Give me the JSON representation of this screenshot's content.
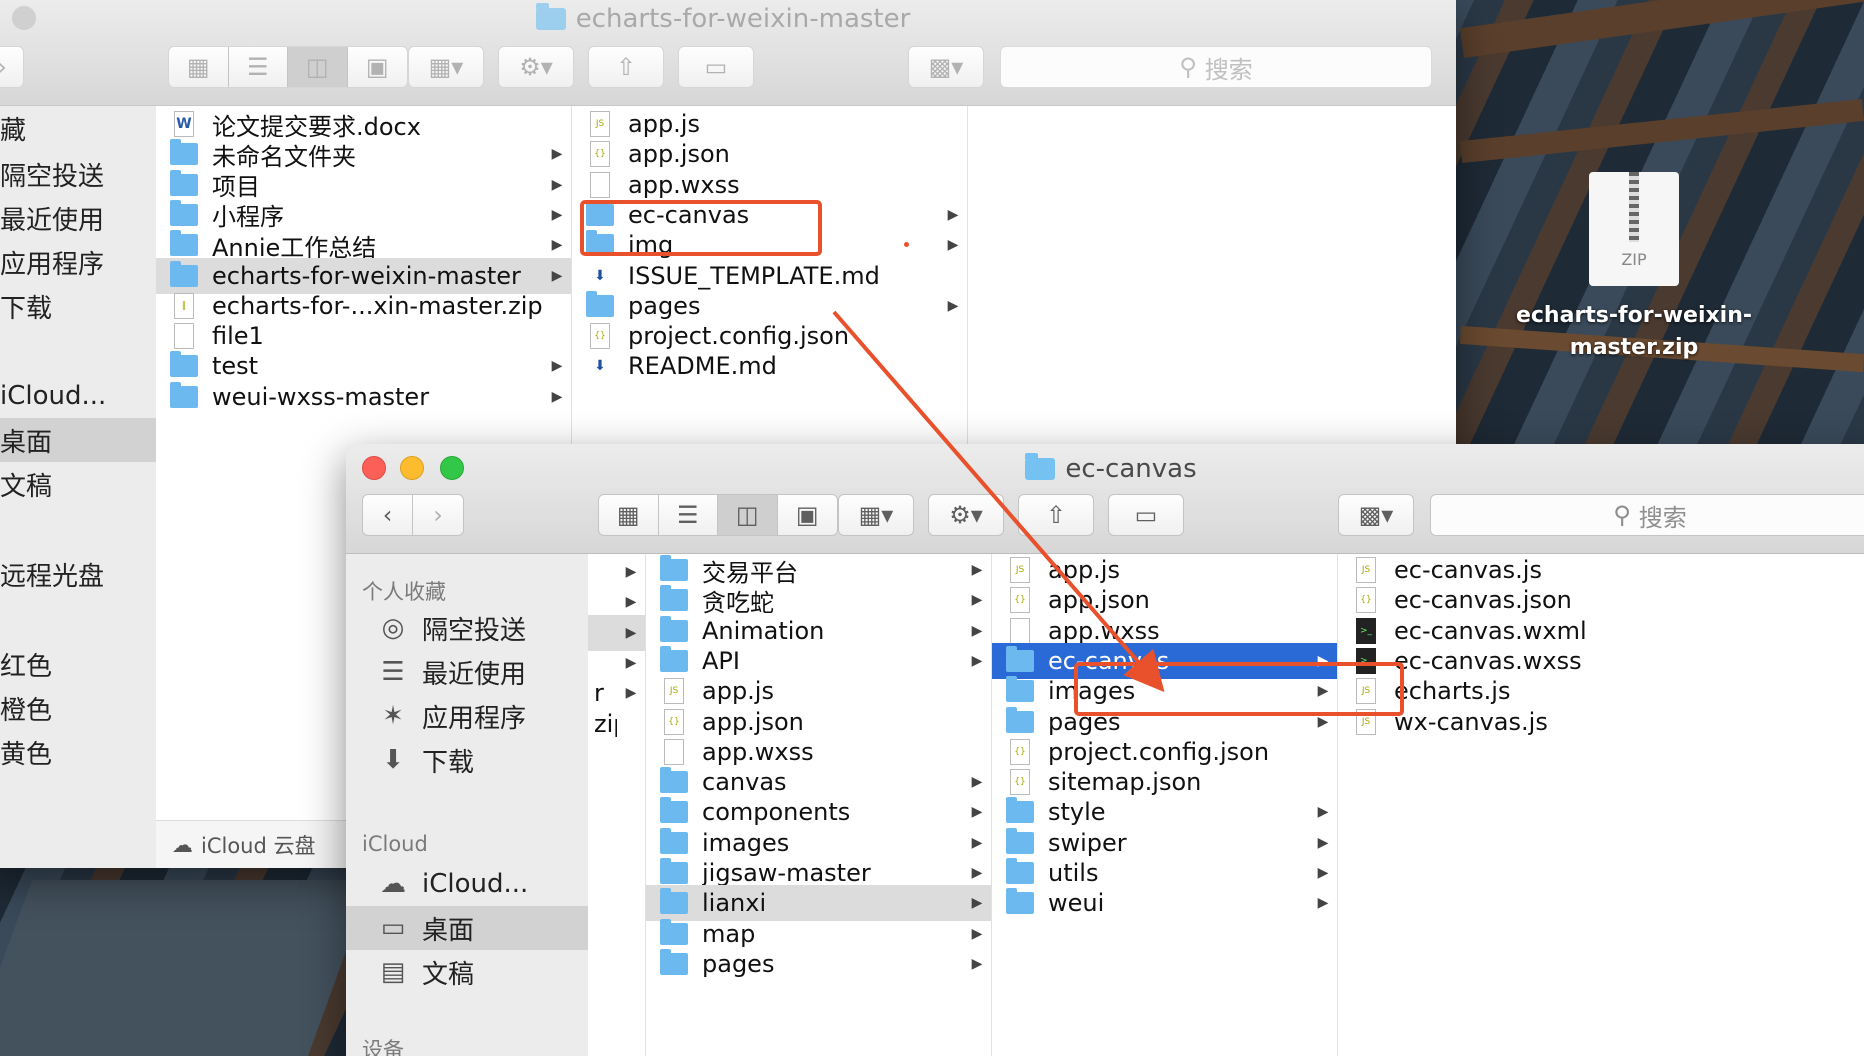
{
  "back_window": {
    "title": "echarts-for-weixin-master",
    "search_placeholder": "搜索",
    "sidebar_items": [
      "藏",
      "隔空投送",
      "最近使用",
      "应用程序",
      "下载",
      "iCloud...",
      "桌面",
      "文稿",
      "远程光盘",
      "红色",
      "橙色",
      "黄色"
    ],
    "icloud_status": "iCloud 云盘",
    "column1": [
      {
        "name": "论文提交要求.docx",
        "type": "word",
        "arrow": false
      },
      {
        "name": "未命名文件夹",
        "type": "folder",
        "arrow": true
      },
      {
        "name": "项目",
        "type": "folder",
        "arrow": true
      },
      {
        "name": "小程序",
        "type": "folder",
        "arrow": true
      },
      {
        "name": "Annie工作总结",
        "type": "folder",
        "arrow": true
      },
      {
        "name": "echarts-for-weixin-master",
        "type": "folder",
        "arrow": true,
        "highlight": true
      },
      {
        "name": "echarts-for-...xin-master.zip",
        "type": "zip",
        "arrow": false
      },
      {
        "name": "file1",
        "type": "file",
        "arrow": false
      },
      {
        "name": "test",
        "type": "folder",
        "arrow": true
      },
      {
        "name": "weui-wxss-master",
        "type": "folder",
        "arrow": true
      }
    ],
    "column2": [
      {
        "name": "app.js",
        "type": "js",
        "arrow": false
      },
      {
        "name": "app.json",
        "type": "json",
        "arrow": false
      },
      {
        "name": "app.wxss",
        "type": "file",
        "arrow": false
      },
      {
        "name": "ec-canvas",
        "type": "folder",
        "arrow": true
      },
      {
        "name": "img",
        "type": "folder",
        "arrow": true
      },
      {
        "name": "ISSUE_TEMPLATE.md",
        "type": "md",
        "arrow": false
      },
      {
        "name": "pages",
        "type": "folder",
        "arrow": true
      },
      {
        "name": "project.config.json",
        "type": "json",
        "arrow": false
      },
      {
        "name": "README.md",
        "type": "md",
        "arrow": false
      }
    ]
  },
  "front_window": {
    "title": "ec-canvas",
    "search_placeholder": "搜索",
    "sidebar": {
      "favorites_header": "个人收藏",
      "favorites": [
        {
          "label": "隔空投送",
          "icon": "airdrop-icon"
        },
        {
          "label": "最近使用",
          "icon": "recents-icon"
        },
        {
          "label": "应用程序",
          "icon": "applications-icon"
        },
        {
          "label": "下载",
          "icon": "downloads-icon"
        }
      ],
      "icloud_header": "iCloud",
      "icloud": [
        {
          "label": "iCloud...",
          "icon": "cloud-icon"
        },
        {
          "label": "桌面",
          "icon": "desktop-icon",
          "selected": true
        },
        {
          "label": "文稿",
          "icon": "documents-icon"
        }
      ],
      "devices_header": "设备"
    },
    "column0": [
      {
        "name": "",
        "arrow": true
      },
      {
        "name": "",
        "arrow": true
      },
      {
        "name": "",
        "arrow": true,
        "highlight": true
      },
      {
        "name": "",
        "arrow": true
      },
      {
        "name": "r",
        "arrow": true
      },
      {
        "name": "zip",
        "arrow": false
      }
    ],
    "column1": [
      {
        "name": "交易平台",
        "type": "folder",
        "arrow": true
      },
      {
        "name": "贪吃蛇",
        "type": "folder",
        "arrow": true
      },
      {
        "name": "Animation",
        "type": "folder",
        "arrow": true
      },
      {
        "name": "API",
        "type": "folder",
        "arrow": true
      },
      {
        "name": "app.js",
        "type": "js",
        "arrow": false
      },
      {
        "name": "app.json",
        "type": "json",
        "arrow": false
      },
      {
        "name": "app.wxss",
        "type": "file",
        "arrow": false
      },
      {
        "name": "canvas",
        "type": "folder",
        "arrow": true
      },
      {
        "name": "components",
        "type": "folder",
        "arrow": true
      },
      {
        "name": "images",
        "type": "folder",
        "arrow": true
      },
      {
        "name": "jigsaw-master",
        "type": "folder",
        "arrow": true
      },
      {
        "name": "lianxi",
        "type": "folder",
        "arrow": true,
        "highlight": true
      },
      {
        "name": "map",
        "type": "folder",
        "arrow": true
      },
      {
        "name": "pages",
        "type": "folder",
        "arrow": true
      }
    ],
    "column2": [
      {
        "name": "app.js",
        "type": "js",
        "arrow": false
      },
      {
        "name": "app.json",
        "type": "json",
        "arrow": false
      },
      {
        "name": "app.wxss",
        "type": "file",
        "arrow": false
      },
      {
        "name": "ec-canvas",
        "type": "folder",
        "arrow": true,
        "selected": true
      },
      {
        "name": "images",
        "type": "folder",
        "arrow": true
      },
      {
        "name": "pages",
        "type": "folder",
        "arrow": true
      },
      {
        "name": "project.config.json",
        "type": "json",
        "arrow": false
      },
      {
        "name": "sitemap.json",
        "type": "json",
        "arrow": false
      },
      {
        "name": "style",
        "type": "folder",
        "arrow": true
      },
      {
        "name": "swiper",
        "type": "folder",
        "arrow": true
      },
      {
        "name": "utils",
        "type": "folder",
        "arrow": true
      },
      {
        "name": "weui",
        "type": "folder",
        "arrow": true
      }
    ],
    "column3": [
      {
        "name": "ec-canvas.js",
        "type": "js"
      },
      {
        "name": "ec-canvas.json",
        "type": "json"
      },
      {
        "name": "ec-canvas.wxml",
        "type": "terminal"
      },
      {
        "name": "ec-canvas.wxss",
        "type": "terminal"
      },
      {
        "name": "echarts.js",
        "type": "js"
      },
      {
        "name": "wx-canvas.js",
        "type": "js"
      }
    ]
  },
  "desktop": {
    "zip_icon_label": "ZIP",
    "zip_name": "echarts-for-weixin-master.zip"
  },
  "colors": {
    "selection": "#2a6ad6",
    "annotation": "#e8512b",
    "folder": "#6cb9f0",
    "close": "#fc5f57",
    "minimize": "#fdbc2e",
    "zoom": "#33c748"
  }
}
